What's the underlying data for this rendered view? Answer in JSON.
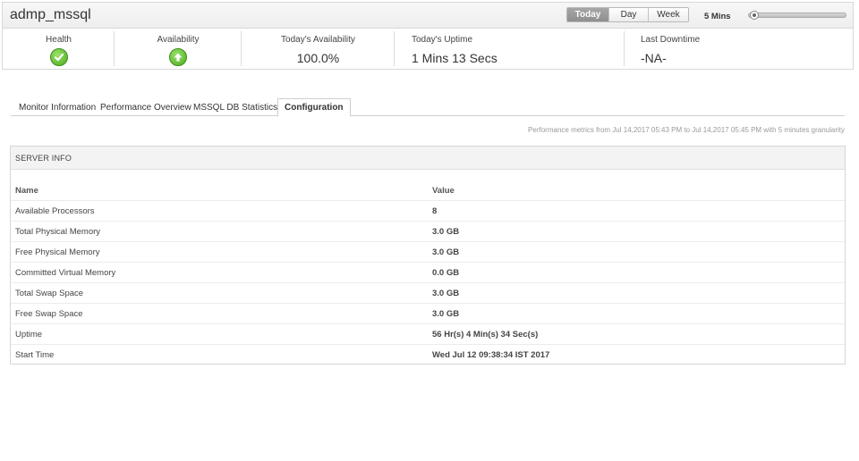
{
  "header": {
    "title": "admp_mssql",
    "periods": [
      "Today",
      "Day",
      "Week"
    ],
    "active_period": "Today",
    "interval": "5 Mins"
  },
  "summary": {
    "health_label": "Health",
    "availability_label": "Availability",
    "todays_availability_label": "Today's Availability",
    "todays_availability_value": "100.0%",
    "todays_uptime_label": "Today's Uptime",
    "todays_uptime_value": "1 Mins 13 Secs",
    "last_downtime_label": "Last Downtime",
    "last_downtime_value": "-NA-",
    "health_icon": "check-icon",
    "availability_icon": "up-arrow-icon",
    "status_color": "#5cb82b"
  },
  "tabs": [
    {
      "label": "Monitor Information"
    },
    {
      "label": "Performance Overview"
    },
    {
      "label": "MSSQL DB Statistics"
    },
    {
      "label": "Configuration"
    }
  ],
  "active_tab": "Configuration",
  "granularity_text": "Performance metrics from Jul 14,2017 05:43 PM to Jul 14,2017 05:45 PM with 5 minutes granularity",
  "server_info": {
    "title": "SERVER INFO",
    "columns": [
      "Name",
      "Value"
    ],
    "rows": [
      [
        "Available Processors",
        "8"
      ],
      [
        "Total Physical Memory",
        "3.0 GB"
      ],
      [
        "Free Physical Memory",
        "3.0 GB"
      ],
      [
        "Committed Virtual Memory",
        "0.0 GB"
      ],
      [
        "Total Swap Space",
        "3.0 GB"
      ],
      [
        "Free Swap Space",
        "3.0 GB"
      ],
      [
        "Uptime",
        "56 Hr(s) 4 Min(s) 34 Sec(s)"
      ],
      [
        "Start Time",
        "Wed Jul 12 09:38:34 IST 2017"
      ]
    ]
  }
}
